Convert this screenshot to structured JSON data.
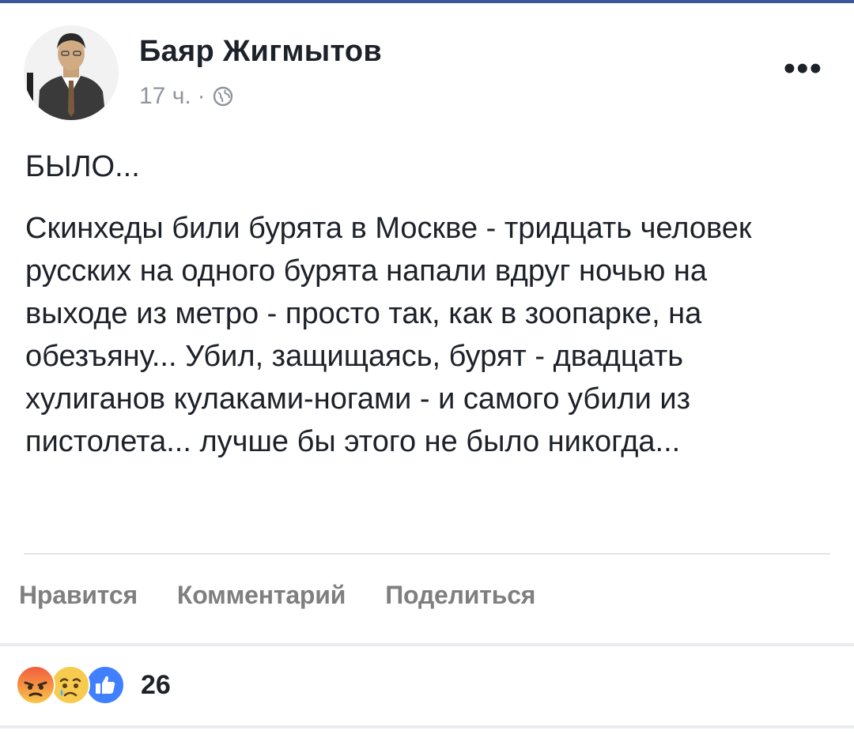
{
  "post": {
    "author_name": "Баяр Жигмытов",
    "timestamp": "17 ч.",
    "separator": "·",
    "audience_icon": "globe-icon",
    "more_label": "•••",
    "title": "БЫЛО...",
    "body": "Скинхеды били бурята в Москве - тридцать человек русских на одного бурята напали вдруг ночью на выходе из метро - просто так, как в зоопарке, на обезъяну... Убил, защищаясь, бурят - двадцать хулиганов кулаками-ногами - и самого убили из пистолета... лучше бы этого не было никогда..."
  },
  "actions": {
    "like": "Нравится",
    "comment": "Комментарий",
    "share": "Поделиться"
  },
  "reactions": {
    "icons": [
      "angry-reaction-icon",
      "sad-reaction-icon",
      "like-reaction-icon"
    ],
    "count": "26"
  },
  "colors": {
    "brand": "#3b5998",
    "text": "#1d2129",
    "muted": "#90949c",
    "action_text": "#7f7f7f",
    "like_blue": "#4080ff"
  }
}
